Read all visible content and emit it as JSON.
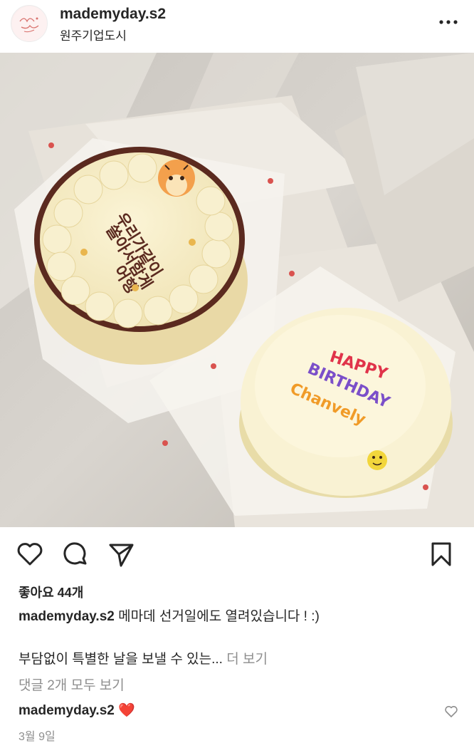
{
  "post": {
    "username": "mademyday.s2",
    "location": "원주기업도시",
    "avatar_text": "made my day",
    "more_label": "•••"
  },
  "photo": {
    "cake1_text": [
      "우리가같이",
      "쏠아서함게",
      "어행"
    ],
    "cake2_text": [
      "HAPPY",
      "BIRTHDAY",
      "Chanvely"
    ]
  },
  "actions": {
    "icons": [
      "heart-icon",
      "comment-icon",
      "share-icon",
      "bookmark-icon"
    ]
  },
  "likes_label": "좋아요 44개",
  "caption": {
    "username": "mademyday.s2",
    "text": "메마데 선거일에도 열려있습니다 ! :)",
    "line2": "부담없이 특별한 날을 보낼 수 있는...",
    "more": "더 보기"
  },
  "comments_link": "댓글 2개 모두 보기",
  "comment": {
    "username": "mademyday.s2",
    "text": "❤️"
  },
  "date": "3월 9일",
  "colors": {
    "text": "#262626",
    "secondary": "#8e8e8e",
    "heart": "#e0102c"
  }
}
